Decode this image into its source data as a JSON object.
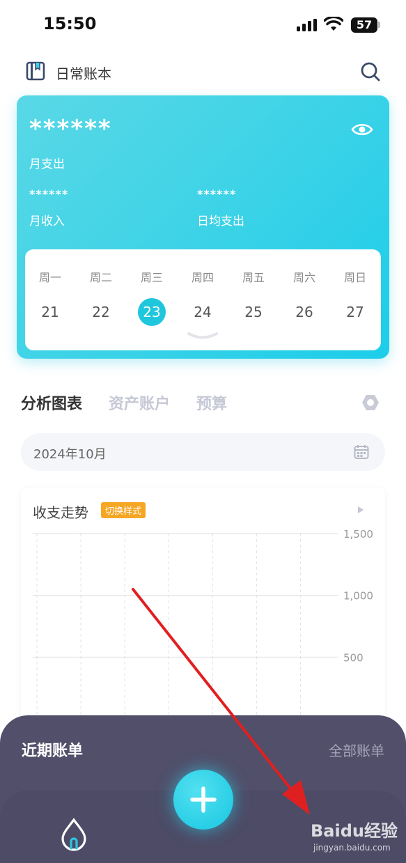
{
  "status_bar": {
    "time": "15:50",
    "battery": "57"
  },
  "header": {
    "title": "日常账本",
    "icons": [
      "book-icon",
      "search-icon"
    ]
  },
  "summary": {
    "monthly_expense_value": "******",
    "monthly_expense_label": "月支出",
    "monthly_income_value": "******",
    "monthly_income_label": "月收入",
    "daily_avg_value": "******",
    "daily_avg_label": "日均支出",
    "visibility_icon": "eye-icon"
  },
  "week": {
    "days": [
      {
        "weekday": "周一",
        "date": "21"
      },
      {
        "weekday": "周二",
        "date": "22"
      },
      {
        "weekday": "周三",
        "date": "23"
      },
      {
        "weekday": "周四",
        "date": "24"
      },
      {
        "weekday": "周五",
        "date": "25"
      },
      {
        "weekday": "周六",
        "date": "26"
      },
      {
        "weekday": "周日",
        "date": "27"
      }
    ],
    "selected": "23"
  },
  "tabs": [
    {
      "label": "分析图表",
      "active": true
    },
    {
      "label": "资产账户",
      "active": false
    },
    {
      "label": "预算",
      "active": false
    }
  ],
  "month_selector": {
    "value": "2024年10月"
  },
  "trend_chart": {
    "title": "收支走势",
    "switch_label": "切换样式"
  },
  "chart_data": {
    "type": "line",
    "title": "收支走势",
    "xlabel": "",
    "ylabel": "",
    "y_ticks": [
      "1,500",
      "1,000",
      "500"
    ],
    "ylim": [
      0,
      1500
    ],
    "series": [],
    "grid": true
  },
  "recent_bills": {
    "title": "近期账单",
    "link": "全部账单"
  },
  "bottom_nav": {
    "add_icon": "plus-icon",
    "home_icon": "drop-icon"
  },
  "watermark": {
    "logo": "Baidu经验",
    "url": "jingyan.baidu.com"
  },
  "colors": {
    "accent": "#1fc7dc",
    "card_gradient_start": "#59d8e6",
    "card_gradient_end": "#1ccdea",
    "badge": "#f5a623",
    "sheet": "#514f6a",
    "annotation_arrow": "#e02020"
  }
}
